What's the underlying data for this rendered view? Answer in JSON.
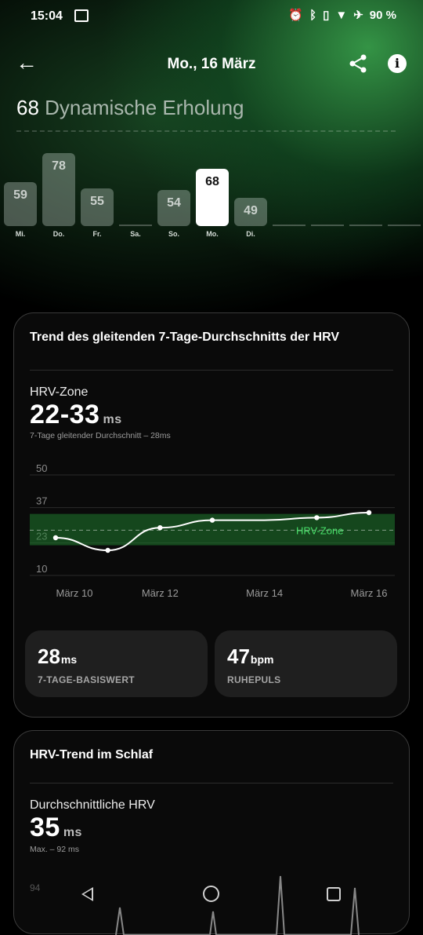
{
  "status": {
    "time": "15:04",
    "battery": "90 %"
  },
  "header": {
    "title": "Mo., 16 März"
  },
  "recovery": {
    "score": "68",
    "label": "Dynamische Erholung",
    "days": [
      {
        "day": "Mi.",
        "value": 59
      },
      {
        "day": "Do.",
        "value": 78
      },
      {
        "day": "Fr.",
        "value": 55
      },
      {
        "day": "Sa.",
        "value": null
      },
      {
        "day": "So.",
        "value": 54
      },
      {
        "day": "Mo.",
        "value": 68,
        "selected": true
      },
      {
        "day": "Di.",
        "value": 49
      },
      {
        "day": "",
        "value": null
      },
      {
        "day": "",
        "value": null
      },
      {
        "day": "",
        "value": null
      },
      {
        "day": "",
        "value": null
      }
    ]
  },
  "hrv_card": {
    "title": "Trend des gleitenden 7-Tage-Durchschnitts der HRV",
    "zone_label": "HRV-Zone",
    "zone_range": "22-33",
    "zone_unit": "ms",
    "avg_note": "7-Tage gleitender Durchschnitt – 28ms",
    "baseline_value": "28",
    "baseline_unit": "ms",
    "baseline_label": "7-TAGE-BASISWERT",
    "pulse_value": "47",
    "pulse_unit": "bpm",
    "pulse_label": "RUHEPULS"
  },
  "chart_data": {
    "type": "line",
    "x": [
      "März 10",
      "März 11",
      "März 12",
      "März 13",
      "März 14",
      "März 15",
      "März 16"
    ],
    "x_ticks": [
      "März 10",
      "März 12",
      "März 14",
      "März 16"
    ],
    "series": [
      {
        "values": [
          25,
          20,
          29,
          32,
          32,
          33,
          35
        ]
      }
    ],
    "y_ticks": [
      50,
      37,
      23,
      10
    ],
    "ylim": [
      10,
      50
    ],
    "zone": {
      "min": 22,
      "max": 33,
      "label": "HRV-Zone",
      "color": "#1f7a2e"
    },
    "average": 28
  },
  "sleep_card": {
    "title": "HRV-Trend im Schlaf",
    "avg_label": "Durchschnittliche HRV",
    "avg_value": "35",
    "avg_unit": "ms",
    "max_note": "Max. – 92 ms",
    "y_top": "94"
  }
}
